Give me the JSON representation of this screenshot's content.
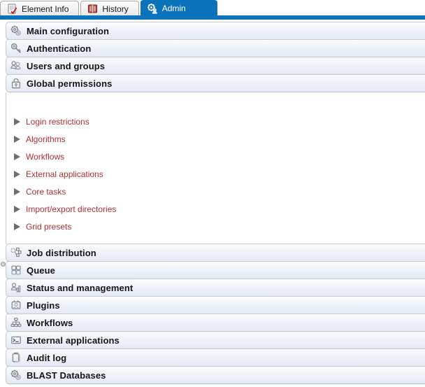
{
  "tabs": [
    {
      "label": "Element Info",
      "icon": "element-info-icon",
      "selected": false
    },
    {
      "label": "History",
      "icon": "history-book-icon",
      "selected": false
    },
    {
      "label": "Admin",
      "icon": "admin-gear-people-icon",
      "selected": true
    }
  ],
  "colors": {
    "accent_blue": "#0b73bb",
    "link_red": "#b03030",
    "header_text": "#15161a",
    "panel_bg": "#eef1f8",
    "panel_border": "#c6c9d0"
  },
  "accordion": {
    "sections_top": [
      {
        "label": "Main configuration",
        "icon": "gears-icon",
        "expanded": false
      },
      {
        "label": "Authentication",
        "icon": "key-icon",
        "expanded": false
      },
      {
        "label": "Users and groups",
        "icon": "users-group-icon",
        "expanded": false
      },
      {
        "label": "Global permissions",
        "icon": "padlock-icon",
        "expanded": true
      }
    ],
    "expanded_section": {
      "label": "Global permissions",
      "items": [
        {
          "label": "Login restrictions",
          "state": "collapsed"
        },
        {
          "label": "Algorithms",
          "state": "collapsed"
        },
        {
          "label": "Workflows",
          "state": "collapsed"
        },
        {
          "label": "External applications",
          "state": "collapsed"
        },
        {
          "label": "Core tasks",
          "state": "collapsed"
        },
        {
          "label": "Import/export directories",
          "state": "collapsed"
        },
        {
          "label": "Grid presets",
          "state": "collapsed"
        }
      ]
    },
    "sections_bottom": [
      {
        "label": "Job distribution",
        "icon": "job-distribution-icon",
        "expanded": false
      },
      {
        "label": "Queue",
        "icon": "queue-blocks-icon",
        "expanded": false
      },
      {
        "label": "Status and management",
        "icon": "status-chart-icon",
        "expanded": false
      },
      {
        "label": "Plugins",
        "icon": "plugin-icon",
        "expanded": false
      },
      {
        "label": "Workflows",
        "icon": "workflow-tree-icon",
        "expanded": false
      },
      {
        "label": "External applications",
        "icon": "terminal-prompt-icon",
        "expanded": false
      },
      {
        "label": "Audit log",
        "icon": "clipboard-icon",
        "expanded": false
      },
      {
        "label": "BLAST Databases",
        "icon": "gears-icon",
        "expanded": false
      }
    ]
  }
}
